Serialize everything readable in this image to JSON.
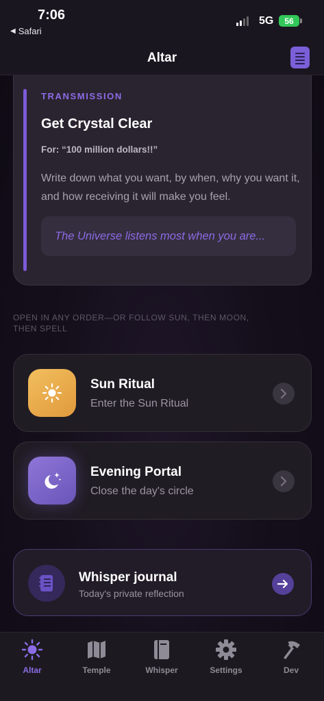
{
  "status_bar": {
    "time": "7:06",
    "back_app": "Safari",
    "network": "5G",
    "battery": "56"
  },
  "nav": {
    "title": "Altar",
    "journal_icon": "journal-icon"
  },
  "transmission": {
    "eyebrow": "TRANSMISSION",
    "title": "Get Crystal Clear",
    "for_line": "For: “100 million dollars!!”",
    "body": "Write down what you want, by when, why you want it, and how receiving it will make you feel.",
    "quote": "The Universe listens most when you are...",
    "accent_color": "#7d5ad8"
  },
  "hint": "OPEN IN ANY ORDER—OR FOLLOW SUN, THEN MOON, THEN SPELL",
  "rituals": [
    {
      "title": "Sun Ritual",
      "subtitle": "Enter the Sun Ritual",
      "icon": "sun-icon",
      "color": "#f2be5e"
    },
    {
      "title": "Evening Portal",
      "subtitle": "Close the day's circle",
      "icon": "moon-stars-icon",
      "color": "#8e76d8"
    }
  ],
  "journal": {
    "title": "Whisper journal",
    "subtitle": "Today's private reflection",
    "icon": "journal-icon"
  },
  "tabs": [
    {
      "label": "Altar",
      "icon": "sun-icon",
      "active": true
    },
    {
      "label": "Temple",
      "icon": "map-icon",
      "active": false
    },
    {
      "label": "Whisper",
      "icon": "book-icon",
      "active": false
    },
    {
      "label": "Settings",
      "icon": "gear-icon",
      "active": false
    },
    {
      "label": "Dev",
      "icon": "hammer-icon",
      "active": false
    }
  ]
}
